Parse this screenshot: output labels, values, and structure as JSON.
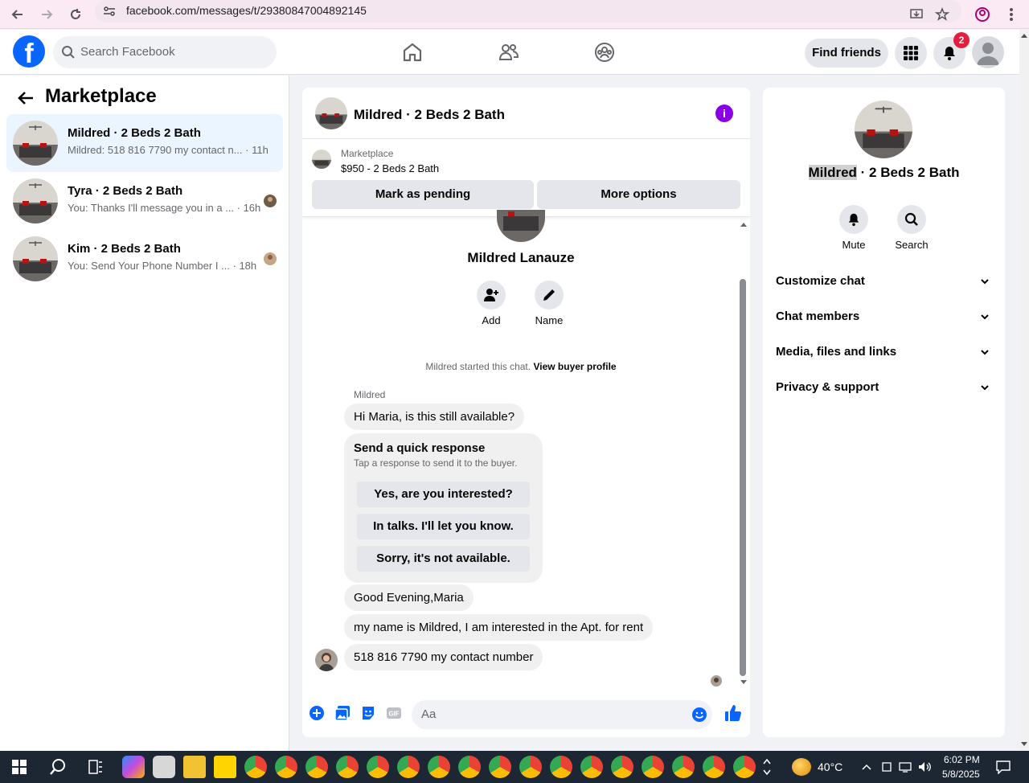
{
  "browser": {
    "url": "facebook.com/messages/t/29380847004892145"
  },
  "topbar": {
    "logo": "f",
    "search_placeholder": "Search Facebook",
    "find_friends": "Find friends",
    "notification_count": "2"
  },
  "left": {
    "title": "Marketplace",
    "conversations": [
      {
        "name": "Mildred · 2 Beds 2 Bath",
        "preview": "Mildred: 518 816 7790 my contact n...",
        "time": "· 11h"
      },
      {
        "name": "Tyra · 2 Beds 2 Bath",
        "preview": "You: Thanks I'll message you in a ...",
        "time": "· 16h"
      },
      {
        "name": "Kim · 2 Beds 2 Bath",
        "preview": "You: Send Your Phone Number I ...",
        "time": "· 18h"
      }
    ]
  },
  "chat": {
    "title": "Mildred · 2 Beds 2 Bath",
    "info_icon": "i",
    "marketplace_label": "Marketplace",
    "listing": "$950 - 2 Beds 2 Bath",
    "mark_pending": "Mark as pending",
    "more_options": "More options",
    "profile_name": "Mildred Lanauze",
    "add_label": "Add",
    "name_label": "Name",
    "started_text": "Mildred started this chat.",
    "view_profile": "View buyer profile",
    "sender": "Mildred",
    "messages": [
      "Hi Maria, is this still available?",
      "Good Evening,Maria",
      "my name is Mildred, I am interested in the Apt. for rent",
      "518 816 7790  my contact number"
    ],
    "quick_response": {
      "title": "Send a quick response",
      "subtitle": "Tap a response to send it to the buyer.",
      "options": [
        "Yes, are you interested?",
        "In talks. I'll let you know.",
        "Sorry, it's not available."
      ]
    },
    "composer_placeholder": "Aa"
  },
  "right": {
    "title_highlight": "Mildred",
    "title_rest": " · 2 Beds 2 Bath",
    "mute": "Mute",
    "search": "Search",
    "sections": [
      "Customize chat",
      "Chat members",
      "Media, files and links",
      "Privacy & support"
    ]
  },
  "taskbar": {
    "temperature": "40°C",
    "time": "6:02 PM",
    "date": "5/8/2025"
  },
  "colors": {
    "fb_blue": "#0866ff",
    "messenger_purple": "#8a00e6",
    "active_conv": "#ebf5ff",
    "badge_red": "#e41e3f"
  }
}
